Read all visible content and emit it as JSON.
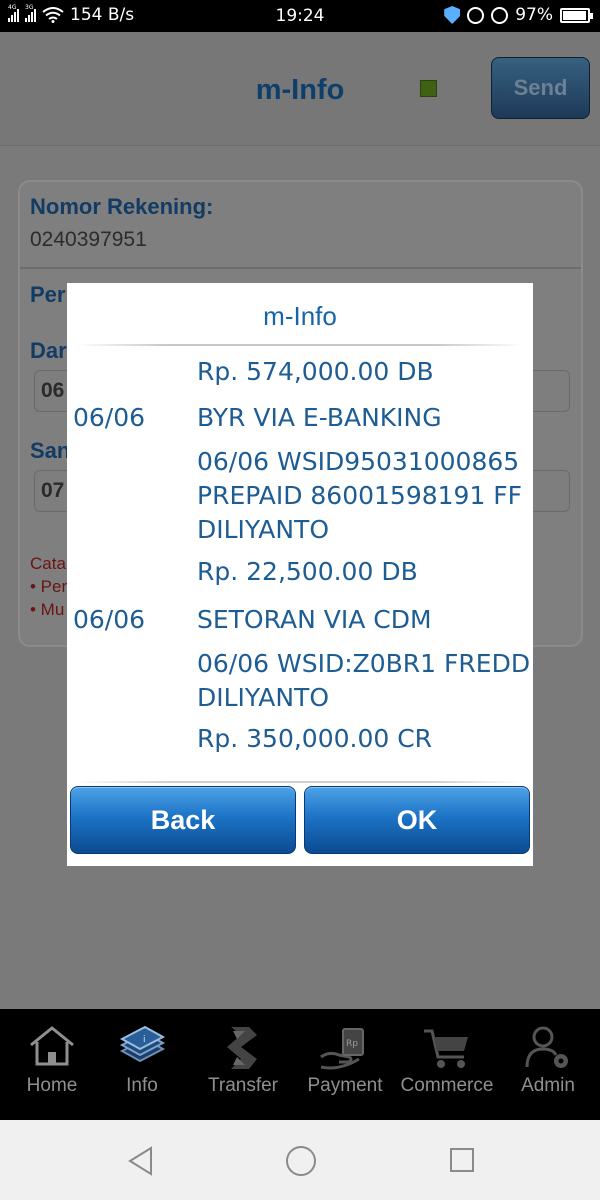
{
  "status_bar": {
    "net_label_1": "4G",
    "net_label_2": "3G",
    "speed": "154 B/s",
    "time": "19:24",
    "battery": "97%"
  },
  "app": {
    "title": "m-Info",
    "send_label": "Send",
    "indicator_color": "#3f6113"
  },
  "form": {
    "account_label": "Nomor Rekening:",
    "account_number": "0240397951",
    "period_label": "Peri",
    "from_label": "Dar",
    "from_value": "06",
    "to_label": "San",
    "to_value": "07",
    "note_label": "Cata",
    "note_line1": "• Per",
    "note_line2": "• Mu"
  },
  "modal": {
    "title": "m-Info",
    "transactions": [
      {
        "date": "",
        "lines": [
          "Rp. 574,000.00 DB"
        ]
      },
      {
        "date": "06/06",
        "lines": [
          "BYR VIA E-BANKING",
          "06/06 WSID95031000865",
          "PREPAID 86001598191 FF",
          "DILIYANTO",
          "Rp. 22,500.00 DB"
        ]
      },
      {
        "date": "06/06",
        "lines": [
          "SETORAN VIA CDM",
          "06/06 WSID:Z0BR1 FREDD",
          "DILIYANTO",
          "Rp. 350,000.00 CR"
        ]
      }
    ],
    "back_label": "Back",
    "ok_label": "OK"
  },
  "bottom_nav": [
    {
      "label": "Home",
      "icon": "home-icon"
    },
    {
      "label": "Info",
      "icon": "info-icon"
    },
    {
      "label": "Transfer",
      "icon": "transfer-icon"
    },
    {
      "label": "Payment",
      "icon": "payment-icon"
    },
    {
      "label": "Commerce",
      "icon": "cart-icon"
    },
    {
      "label": "Admin",
      "icon": "admin-icon"
    }
  ],
  "colors": {
    "accent": "#1765a8",
    "button_blue": "#1d73c6"
  }
}
